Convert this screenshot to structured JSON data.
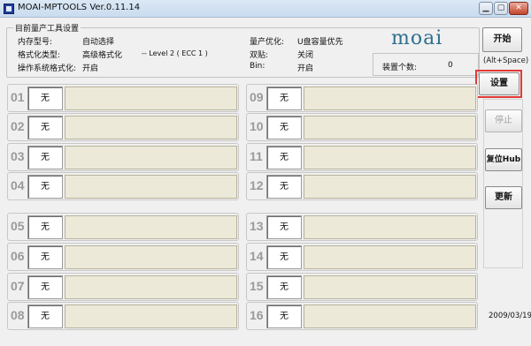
{
  "window": {
    "title": "MOAI-MPTOOLS Ver.0.11.14"
  },
  "settings": {
    "legend": "目前量产工具设置",
    "memory_type_label": "内存型号:",
    "memory_type_value": "自动选择",
    "format_type_label": "格式化类型:",
    "format_type_value": "高级格式化",
    "level_text": "-- Level 2 ( ECC 1 )",
    "os_format_label": "操作系统格式化:",
    "os_format_value": "开启",
    "optimize_label": "量产优化:",
    "optimize_value": "U盘容量优先",
    "dual_label": "双贴:",
    "dual_value": "关闭",
    "bin_label": "Bin:",
    "bin_value": "开启"
  },
  "device_count": {
    "label": "装置个数:",
    "value": "0"
  },
  "logo": {
    "text": "moai",
    "color": "#2e6f8e"
  },
  "buttons": {
    "start": "开始",
    "start_hint": "(Alt+Space)",
    "settings": "设置",
    "stop": "停止",
    "reset_hub": "复位Hub",
    "refresh": "更新"
  },
  "slots": [
    {
      "num": "01",
      "status": "无"
    },
    {
      "num": "02",
      "status": "无"
    },
    {
      "num": "03",
      "status": "无"
    },
    {
      "num": "04",
      "status": "无"
    },
    {
      "num": "05",
      "status": "无"
    },
    {
      "num": "06",
      "status": "无"
    },
    {
      "num": "07",
      "status": "无"
    },
    {
      "num": "08",
      "status": "无"
    },
    {
      "num": "09",
      "status": "无"
    },
    {
      "num": "10",
      "status": "无"
    },
    {
      "num": "11",
      "status": "无"
    },
    {
      "num": "12",
      "status": "无"
    },
    {
      "num": "13",
      "status": "无"
    },
    {
      "num": "14",
      "status": "无"
    },
    {
      "num": "15",
      "status": "无"
    },
    {
      "num": "16",
      "status": "无"
    }
  ],
  "footer": {
    "date": "2009/03/19"
  },
  "colors": {
    "highlight": "#e03a36",
    "progress_bg": "#ece9d8"
  }
}
